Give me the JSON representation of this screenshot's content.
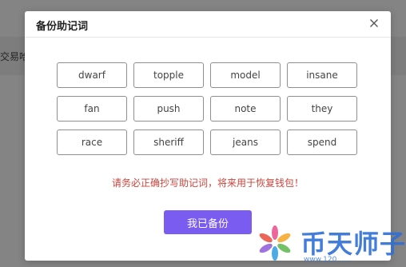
{
  "background": {
    "partial_text": "交易哈"
  },
  "modal": {
    "title": "备份助记词",
    "close_icon": "close-icon",
    "words": [
      "dwarf",
      "topple",
      "model",
      "insane",
      "fan",
      "push",
      "note",
      "they",
      "race",
      "sheriff",
      "jeans",
      "spend"
    ],
    "warning": "请务必正确抄写助记词，将来用于恢复钱包！",
    "confirm_label": "我已备份"
  },
  "watermark": {
    "text": "币天师子",
    "url": "www.120……",
    "icon": "flower-logo-icon"
  },
  "colors": {
    "accent": "#7b5cf0",
    "warning": "#c9463d",
    "watermark": "#2f6fd6"
  }
}
